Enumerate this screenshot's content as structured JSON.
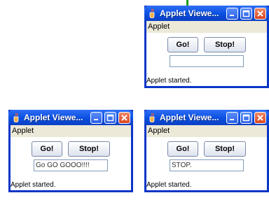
{
  "windows": [
    {
      "title": "Applet Viewe...",
      "menu": "Applet",
      "go_label": "Go!",
      "stop_label": "Stop!",
      "field_value": "",
      "status": "Applet started."
    },
    {
      "title": "Applet Viewe...",
      "menu": "Applet",
      "go_label": "Go!",
      "stop_label": "Stop!",
      "field_value": "Go GO GOOO!!!!",
      "status": "Applet started."
    },
    {
      "title": "Applet Viewe...",
      "menu": "Applet",
      "go_label": "Go!",
      "stop_label": "Stop!",
      "field_value": "STOP.",
      "status": "Applet started."
    }
  ],
  "icons": {
    "app": "java-cup-icon",
    "minimize": "minimize-icon",
    "maximize": "maximize-icon",
    "close": "close-icon"
  },
  "colors": {
    "frame": "#0a36c8",
    "titlebar": "#2e6ff5",
    "close_button": "#d8431e",
    "menubar": "#ece9d8"
  }
}
